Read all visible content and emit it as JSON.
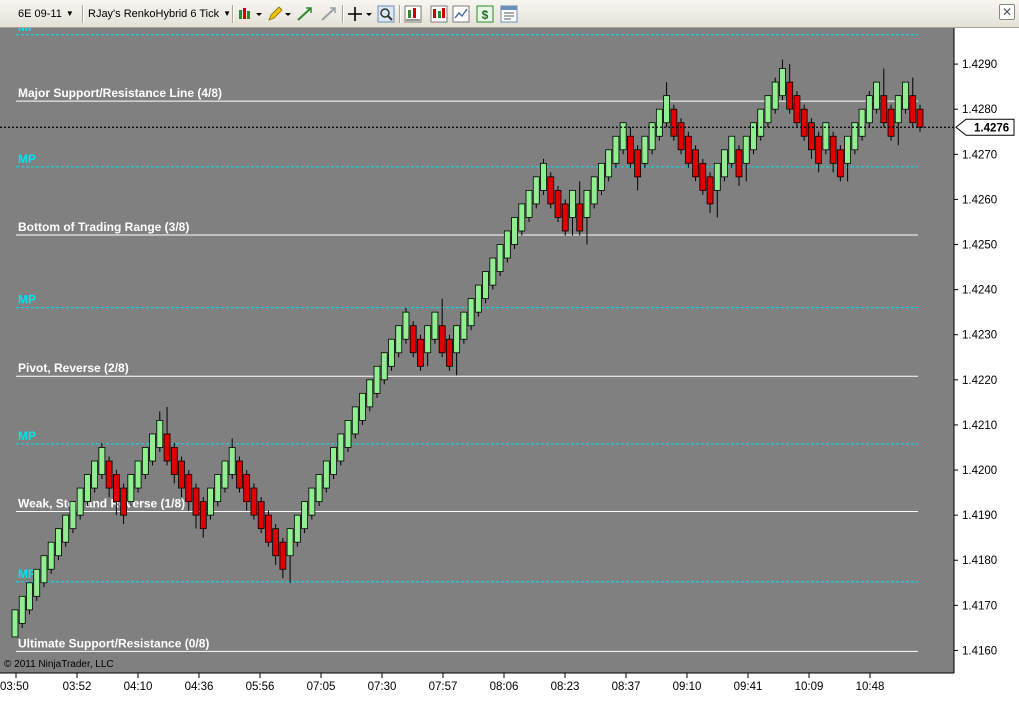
{
  "toolbar": {
    "instrument": "6E 09-11",
    "period": "RJay's RenkoHybrid  6 Tick",
    "icons": [
      "bar-style-icon",
      "pencil-draw-icon",
      "crosshair-icon",
      "zoom-icon",
      "indicators-icon",
      "strategies-icon",
      "chart-trader-icon",
      "data-box-icon",
      "properties-icon"
    ]
  },
  "colors": {
    "background": "#808080",
    "up_bar": "#90ee90",
    "down_bar": "#e00000",
    "mp_line": "#00e5ee",
    "level_line": "#ffffff"
  },
  "price_marker": "1.4276",
  "copyright": "© 2011 NinjaTrader, LLC",
  "chart_data": {
    "type": "candlestick",
    "ylim": [
      1.4155,
      1.4298
    ],
    "y_ticks": [
      "1.4290",
      "1.4280",
      "1.4270",
      "1.4260",
      "1.4250",
      "1.4240",
      "1.4230",
      "1.4220",
      "1.4210",
      "1.4200",
      "1.4190",
      "1.4180",
      "1.4170",
      "1.4160"
    ],
    "x_ticks": [
      "03:50",
      "03:52",
      "04:10",
      "04:36",
      "05:56",
      "07:05",
      "07:30",
      "07:57",
      "08:06",
      "08:23",
      "08:37",
      "09:10",
      "09:41",
      "10:09",
      "10:48"
    ],
    "current_price": 1.4276,
    "levels": [
      {
        "label": "MP",
        "price": 1.42965,
        "style": "mp"
      },
      {
        "label": "Major Support/Resistance Line (4/8)",
        "price": 1.42818,
        "style": "level"
      },
      {
        "label": "MP",
        "price": 1.42672,
        "style": "mp"
      },
      {
        "label": "Bottom of Trading Range (3/8)",
        "price": 1.42521,
        "style": "level"
      },
      {
        "label": "MP",
        "price": 1.4236,
        "style": "mp"
      },
      {
        "label": "Pivot, Reverse (2/8)",
        "price": 1.42208,
        "style": "level"
      },
      {
        "label": "MP",
        "price": 1.42058,
        "style": "mp"
      },
      {
        "label": "Weak, Stop and Reverse (1/8)",
        "price": 1.41908,
        "style": "level"
      },
      {
        "label": "MP",
        "price": 1.41752,
        "style": "mp"
      },
      {
        "label": "Ultimate Support/Resistance (0/8)",
        "price": 1.41598,
        "style": "level"
      }
    ],
    "bars": [
      {
        "o": 1.4163,
        "c": 1.4169,
        "h": 1.4169,
        "l": 1.4163
      },
      {
        "o": 1.4166,
        "c": 1.4172,
        "h": 1.4172,
        "l": 1.4165
      },
      {
        "o": 1.4169,
        "c": 1.4175,
        "h": 1.4175,
        "l": 1.4168
      },
      {
        "o": 1.4172,
        "c": 1.4178,
        "h": 1.4178,
        "l": 1.4171
      },
      {
        "o": 1.4175,
        "c": 1.4181,
        "h": 1.4181,
        "l": 1.4174
      },
      {
        "o": 1.4178,
        "c": 1.4184,
        "h": 1.4184,
        "l": 1.4177
      },
      {
        "o": 1.4181,
        "c": 1.4187,
        "h": 1.4187,
        "l": 1.418
      },
      {
        "o": 1.4184,
        "c": 1.419,
        "h": 1.419,
        "l": 1.4183
      },
      {
        "o": 1.4187,
        "c": 1.4193,
        "h": 1.4193,
        "l": 1.4186
      },
      {
        "o": 1.419,
        "c": 1.4196,
        "h": 1.4196,
        "l": 1.4189
      },
      {
        "o": 1.4193,
        "c": 1.4199,
        "h": 1.4199,
        "l": 1.4192
      },
      {
        "o": 1.4196,
        "c": 1.4202,
        "h": 1.4202,
        "l": 1.4195
      },
      {
        "o": 1.4199,
        "c": 1.4205,
        "h": 1.4206,
        "l": 1.4198
      },
      {
        "o": 1.4202,
        "c": 1.4196,
        "h": 1.4203,
        "l": 1.4194
      },
      {
        "o": 1.4199,
        "c": 1.4193,
        "h": 1.42,
        "l": 1.419
      },
      {
        "o": 1.4196,
        "c": 1.419,
        "h": 1.4197,
        "l": 1.4188
      },
      {
        "o": 1.4193,
        "c": 1.4199,
        "h": 1.4199,
        "l": 1.4192
      },
      {
        "o": 1.4196,
        "c": 1.4202,
        "h": 1.4202,
        "l": 1.4195
      },
      {
        "o": 1.4199,
        "c": 1.4205,
        "h": 1.4205,
        "l": 1.4198
      },
      {
        "o": 1.4202,
        "c": 1.4208,
        "h": 1.4208,
        "l": 1.4201
      },
      {
        "o": 1.4205,
        "c": 1.4211,
        "h": 1.4213,
        "l": 1.4204
      },
      {
        "o": 1.4208,
        "c": 1.4202,
        "h": 1.4214,
        "l": 1.4201
      },
      {
        "o": 1.4205,
        "c": 1.4199,
        "h": 1.4206,
        "l": 1.4197
      },
      {
        "o": 1.4202,
        "c": 1.4196,
        "h": 1.4203,
        "l": 1.4194
      },
      {
        "o": 1.4199,
        "c": 1.4193,
        "h": 1.42,
        "l": 1.4191
      },
      {
        "o": 1.4196,
        "c": 1.419,
        "h": 1.4197,
        "l": 1.4187
      },
      {
        "o": 1.4193,
        "c": 1.4187,
        "h": 1.4194,
        "l": 1.4185
      },
      {
        "o": 1.419,
        "c": 1.4196,
        "h": 1.4196,
        "l": 1.4189
      },
      {
        "o": 1.4193,
        "c": 1.4199,
        "h": 1.4199,
        "l": 1.4192
      },
      {
        "o": 1.4196,
        "c": 1.4202,
        "h": 1.4202,
        "l": 1.4195
      },
      {
        "o": 1.4199,
        "c": 1.4205,
        "h": 1.4207,
        "l": 1.4198
      },
      {
        "o": 1.4202,
        "c": 1.4196,
        "h": 1.4203,
        "l": 1.4195
      },
      {
        "o": 1.4199,
        "c": 1.4193,
        "h": 1.42,
        "l": 1.4191
      },
      {
        "o": 1.4196,
        "c": 1.419,
        "h": 1.4197,
        "l": 1.4189
      },
      {
        "o": 1.4193,
        "c": 1.4187,
        "h": 1.4194,
        "l": 1.4186
      },
      {
        "o": 1.419,
        "c": 1.4184,
        "h": 1.4191,
        "l": 1.4183
      },
      {
        "o": 1.4187,
        "c": 1.4181,
        "h": 1.4188,
        "l": 1.4179
      },
      {
        "o": 1.4184,
        "c": 1.4178,
        "h": 1.4185,
        "l": 1.4176
      },
      {
        "o": 1.4181,
        "c": 1.4187,
        "h": 1.4187,
        "l": 1.4175
      },
      {
        "o": 1.4184,
        "c": 1.419,
        "h": 1.419,
        "l": 1.4183
      },
      {
        "o": 1.4187,
        "c": 1.4193,
        "h": 1.4193,
        "l": 1.4186
      },
      {
        "o": 1.419,
        "c": 1.4196,
        "h": 1.4196,
        "l": 1.4189
      },
      {
        "o": 1.4193,
        "c": 1.4199,
        "h": 1.4199,
        "l": 1.4192
      },
      {
        "o": 1.4196,
        "c": 1.4202,
        "h": 1.4202,
        "l": 1.4195
      },
      {
        "o": 1.4199,
        "c": 1.4205,
        "h": 1.4205,
        "l": 1.4198
      },
      {
        "o": 1.4202,
        "c": 1.4208,
        "h": 1.4208,
        "l": 1.4201
      },
      {
        "o": 1.4205,
        "c": 1.4211,
        "h": 1.4211,
        "l": 1.4204
      },
      {
        "o": 1.4208,
        "c": 1.4214,
        "h": 1.4214,
        "l": 1.4207
      },
      {
        "o": 1.4211,
        "c": 1.4217,
        "h": 1.4217,
        "l": 1.421
      },
      {
        "o": 1.4214,
        "c": 1.422,
        "h": 1.422,
        "l": 1.4213
      },
      {
        "o": 1.4217,
        "c": 1.4223,
        "h": 1.4223,
        "l": 1.4216
      },
      {
        "o": 1.422,
        "c": 1.4226,
        "h": 1.4226,
        "l": 1.4219
      },
      {
        "o": 1.4223,
        "c": 1.4229,
        "h": 1.4229,
        "l": 1.4222
      },
      {
        "o": 1.4226,
        "c": 1.4232,
        "h": 1.4232,
        "l": 1.4225
      },
      {
        "o": 1.4229,
        "c": 1.4235,
        "h": 1.4236,
        "l": 1.4228
      },
      {
        "o": 1.4232,
        "c": 1.4226,
        "h": 1.4233,
        "l": 1.4225
      },
      {
        "o": 1.4229,
        "c": 1.4223,
        "h": 1.423,
        "l": 1.4222
      },
      {
        "o": 1.4226,
        "c": 1.4232,
        "h": 1.4232,
        "l": 1.4223
      },
      {
        "o": 1.4229,
        "c": 1.4235,
        "h": 1.4235,
        "l": 1.4228
      },
      {
        "o": 1.4232,
        "c": 1.4226,
        "h": 1.4238,
        "l": 1.4225
      },
      {
        "o": 1.4229,
        "c": 1.4223,
        "h": 1.423,
        "l": 1.4222
      },
      {
        "o": 1.4226,
        "c": 1.4232,
        "h": 1.4232,
        "l": 1.4221
      },
      {
        "o": 1.4229,
        "c": 1.4235,
        "h": 1.4235,
        "l": 1.4228
      },
      {
        "o": 1.4232,
        "c": 1.4238,
        "h": 1.4238,
        "l": 1.4231
      },
      {
        "o": 1.4235,
        "c": 1.4241,
        "h": 1.4241,
        "l": 1.4234
      },
      {
        "o": 1.4238,
        "c": 1.4244,
        "h": 1.4244,
        "l": 1.4237
      },
      {
        "o": 1.4241,
        "c": 1.4247,
        "h": 1.4247,
        "l": 1.424
      },
      {
        "o": 1.4244,
        "c": 1.425,
        "h": 1.425,
        "l": 1.4243
      },
      {
        "o": 1.4247,
        "c": 1.4253,
        "h": 1.4253,
        "l": 1.4246
      },
      {
        "o": 1.425,
        "c": 1.4256,
        "h": 1.4256,
        "l": 1.4249
      },
      {
        "o": 1.4253,
        "c": 1.4259,
        "h": 1.4259,
        "l": 1.4252
      },
      {
        "o": 1.4256,
        "c": 1.4262,
        "h": 1.4262,
        "l": 1.4255
      },
      {
        "o": 1.4259,
        "c": 1.4265,
        "h": 1.4265,
        "l": 1.4258
      },
      {
        "o": 1.4262,
        "c": 1.4268,
        "h": 1.4269,
        "l": 1.4261
      },
      {
        "o": 1.4265,
        "c": 1.4259,
        "h": 1.4266,
        "l": 1.4258
      },
      {
        "o": 1.4262,
        "c": 1.4256,
        "h": 1.4263,
        "l": 1.4255
      },
      {
        "o": 1.4259,
        "c": 1.4253,
        "h": 1.426,
        "l": 1.4252
      },
      {
        "o": 1.4256,
        "c": 1.4262,
        "h": 1.4262,
        "l": 1.4252
      },
      {
        "o": 1.4259,
        "c": 1.4253,
        "h": 1.4264,
        "l": 1.4252
      },
      {
        "o": 1.4256,
        "c": 1.4262,
        "h": 1.4262,
        "l": 1.425
      },
      {
        "o": 1.4259,
        "c": 1.4265,
        "h": 1.4265,
        "l": 1.4258
      },
      {
        "o": 1.4262,
        "c": 1.4268,
        "h": 1.4268,
        "l": 1.4261
      },
      {
        "o": 1.4265,
        "c": 1.4271,
        "h": 1.4271,
        "l": 1.4264
      },
      {
        "o": 1.4268,
        "c": 1.4274,
        "h": 1.4274,
        "l": 1.4267
      },
      {
        "o": 1.4271,
        "c": 1.4277,
        "h": 1.4277,
        "l": 1.427
      },
      {
        "o": 1.4274,
        "c": 1.4268,
        "h": 1.4276,
        "l": 1.4267
      },
      {
        "o": 1.4271,
        "c": 1.4265,
        "h": 1.4272,
        "l": 1.4262
      },
      {
        "o": 1.4268,
        "c": 1.4274,
        "h": 1.4274,
        "l": 1.4267
      },
      {
        "o": 1.4271,
        "c": 1.4277,
        "h": 1.4277,
        "l": 1.427
      },
      {
        "o": 1.4274,
        "c": 1.428,
        "h": 1.428,
        "l": 1.4273
      },
      {
        "o": 1.4277,
        "c": 1.4283,
        "h": 1.4286,
        "l": 1.4276
      },
      {
        "o": 1.428,
        "c": 1.4274,
        "h": 1.4281,
        "l": 1.4273
      },
      {
        "o": 1.4277,
        "c": 1.4271,
        "h": 1.4278,
        "l": 1.427
      },
      {
        "o": 1.4274,
        "c": 1.4268,
        "h": 1.4275,
        "l": 1.4267
      },
      {
        "o": 1.4271,
        "c": 1.4265,
        "h": 1.4272,
        "l": 1.4264
      },
      {
        "o": 1.4268,
        "c": 1.4262,
        "h": 1.4269,
        "l": 1.4261
      },
      {
        "o": 1.4265,
        "c": 1.4259,
        "h": 1.4266,
        "l": 1.4257
      },
      {
        "o": 1.4262,
        "c": 1.4268,
        "h": 1.4268,
        "l": 1.4256
      },
      {
        "o": 1.4265,
        "c": 1.4271,
        "h": 1.4271,
        "l": 1.4264
      },
      {
        "o": 1.4268,
        "c": 1.4274,
        "h": 1.4274,
        "l": 1.4267
      },
      {
        "o": 1.4271,
        "c": 1.4265,
        "h": 1.4272,
        "l": 1.4263
      },
      {
        "o": 1.4268,
        "c": 1.4274,
        "h": 1.4274,
        "l": 1.4264
      },
      {
        "o": 1.4271,
        "c": 1.4277,
        "h": 1.4277,
        "l": 1.427
      },
      {
        "o": 1.4274,
        "c": 1.428,
        "h": 1.428,
        "l": 1.4273
      },
      {
        "o": 1.4277,
        "c": 1.4283,
        "h": 1.4283,
        "l": 1.4276
      },
      {
        "o": 1.428,
        "c": 1.4286,
        "h": 1.4287,
        "l": 1.4279
      },
      {
        "o": 1.4283,
        "c": 1.4289,
        "h": 1.4291,
        "l": 1.4282
      },
      {
        "o": 1.4286,
        "c": 1.428,
        "h": 1.429,
        "l": 1.4279
      },
      {
        "o": 1.4283,
        "c": 1.4277,
        "h": 1.4284,
        "l": 1.4276
      },
      {
        "o": 1.428,
        "c": 1.4274,
        "h": 1.4281,
        "l": 1.4273
      },
      {
        "o": 1.4277,
        "c": 1.4271,
        "h": 1.4278,
        "l": 1.4269
      },
      {
        "o": 1.4274,
        "c": 1.4268,
        "h": 1.4275,
        "l": 1.4266
      },
      {
        "o": 1.4271,
        "c": 1.4277,
        "h": 1.4277,
        "l": 1.427
      },
      {
        "o": 1.4274,
        "c": 1.4268,
        "h": 1.4275,
        "l": 1.4266
      },
      {
        "o": 1.4271,
        "c": 1.4265,
        "h": 1.4272,
        "l": 1.4264
      },
      {
        "o": 1.4268,
        "c": 1.4274,
        "h": 1.4274,
        "l": 1.4264
      },
      {
        "o": 1.4271,
        "c": 1.4277,
        "h": 1.4277,
        "l": 1.427
      },
      {
        "o": 1.4274,
        "c": 1.428,
        "h": 1.428,
        "l": 1.4273
      },
      {
        "o": 1.4277,
        "c": 1.4283,
        "h": 1.4284,
        "l": 1.4276
      },
      {
        "o": 1.428,
        "c": 1.4286,
        "h": 1.4286,
        "l": 1.4279
      },
      {
        "o": 1.4283,
        "c": 1.4277,
        "h": 1.4289,
        "l": 1.4276
      },
      {
        "o": 1.428,
        "c": 1.4274,
        "h": 1.4281,
        "l": 1.4273
      },
      {
        "o": 1.4277,
        "c": 1.4283,
        "h": 1.4283,
        "l": 1.4272
      },
      {
        "o": 1.428,
        "c": 1.4286,
        "h": 1.4286,
        "l": 1.4279
      },
      {
        "o": 1.4283,
        "c": 1.4277,
        "h": 1.4287,
        "l": 1.4276
      },
      {
        "o": 1.428,
        "c": 1.4276,
        "h": 1.4281,
        "l": 1.4275
      }
    ]
  }
}
